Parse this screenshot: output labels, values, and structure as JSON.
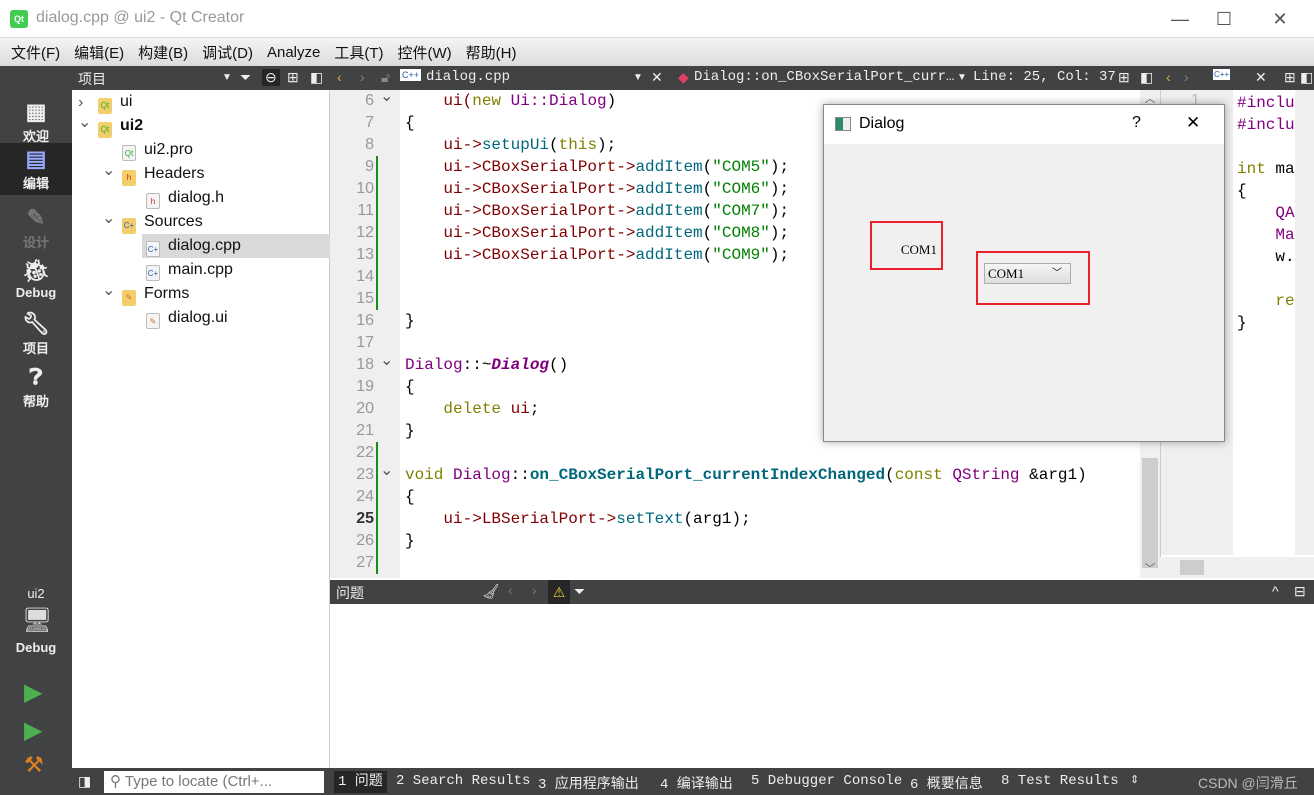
{
  "window": {
    "title": "dialog.cpp @ ui2 - Qt Creator",
    "logo": "Qt",
    "minimize": "—",
    "maximize": "☐",
    "close": "✕"
  },
  "menu": [
    "文件(F)",
    "编辑(E)",
    "构建(B)",
    "调试(D)",
    "Analyze",
    "工具(T)",
    "控件(W)",
    "帮助(H)"
  ],
  "toolbar": {
    "project_label": "项目",
    "file_name": "dialog.cpp",
    "symbol": "Dialog::on_CBoxSerialPort_curr…",
    "position": "Line: 25, Col: 37"
  },
  "modes": [
    {
      "label": "欢迎",
      "icon": "grid-icon"
    },
    {
      "label": "编辑",
      "icon": "edit-icon",
      "selected": true
    },
    {
      "label": "设计",
      "icon": "pencil-icon",
      "disabled": true
    },
    {
      "label": "Debug",
      "icon": "bug-icon"
    },
    {
      "label": "项目",
      "icon": "wrench-icon"
    },
    {
      "label": "帮助",
      "icon": "help-icon"
    }
  ],
  "kit": {
    "project": "ui2",
    "config": "Debug"
  },
  "tree": [
    {
      "label": "ui",
      "level": 0,
      "expand": "collapsed",
      "kind": "qt-folder"
    },
    {
      "label": "ui2",
      "level": 0,
      "expand": "expanded",
      "kind": "qt-folder",
      "bold": true
    },
    {
      "label": "ui2.pro",
      "level": 1,
      "kind": "pro-file"
    },
    {
      "label": "Headers",
      "level": 1,
      "expand": "expanded",
      "kind": "h-folder"
    },
    {
      "label": "dialog.h",
      "level": 2,
      "kind": "h-file"
    },
    {
      "label": "Sources",
      "level": 1,
      "expand": "expanded",
      "kind": "cpp-folder"
    },
    {
      "label": "dialog.cpp",
      "level": 2,
      "kind": "cpp-file",
      "selected": true
    },
    {
      "label": "main.cpp",
      "level": 2,
      "kind": "cpp-file"
    },
    {
      "label": "Forms",
      "level": 1,
      "expand": "expanded",
      "kind": "ui-folder"
    },
    {
      "label": "dialog.ui",
      "level": 2,
      "kind": "ui-file"
    }
  ],
  "editor": {
    "current_line": 25,
    "lines": [
      {
        "n": 6,
        "fold": true,
        "t": [
          [
            "    ui(",
            "mb"
          ],
          [
            "new ",
            "k"
          ],
          [
            "Ui::Dialog",
            "ty"
          ],
          [
            ")",
            "pl"
          ]
        ]
      },
      {
        "n": 7,
        "t": [
          [
            "{",
            "pl"
          ]
        ]
      },
      {
        "n": 8,
        "t": [
          [
            "    ui->",
            "mb"
          ],
          [
            "setupUi",
            "fn"
          ],
          [
            "(",
            "pl"
          ],
          [
            "this",
            "k"
          ],
          [
            ");",
            "pl"
          ]
        ]
      },
      {
        "n": 9,
        "chg": true,
        "t": [
          [
            "    ui->CBoxSerialPort->",
            "mb"
          ],
          [
            "addItem",
            "fn"
          ],
          [
            "(",
            "pl"
          ],
          [
            "\"COM5\"",
            "st"
          ],
          [
            ");",
            "pl"
          ]
        ]
      },
      {
        "n": 10,
        "chg": true,
        "t": [
          [
            "    ui->CBoxSerialPort->",
            "mb"
          ],
          [
            "addItem",
            "fn"
          ],
          [
            "(",
            "pl"
          ],
          [
            "\"COM6\"",
            "st"
          ],
          [
            ");",
            "pl"
          ]
        ]
      },
      {
        "n": 11,
        "chg": true,
        "t": [
          [
            "    ui->CBoxSerialPort->",
            "mb"
          ],
          [
            "addItem",
            "fn"
          ],
          [
            "(",
            "pl"
          ],
          [
            "\"COM7\"",
            "st"
          ],
          [
            ");",
            "pl"
          ]
        ]
      },
      {
        "n": 12,
        "chg": true,
        "t": [
          [
            "    ui->CBoxSerialPort->",
            "mb"
          ],
          [
            "addItem",
            "fn"
          ],
          [
            "(",
            "pl"
          ],
          [
            "\"COM8\"",
            "st"
          ],
          [
            ");",
            "pl"
          ]
        ]
      },
      {
        "n": 13,
        "chg": true,
        "t": [
          [
            "    ui->CBoxSerialPort->",
            "mb"
          ],
          [
            "addItem",
            "fn"
          ],
          [
            "(",
            "pl"
          ],
          [
            "\"COM9\"",
            "st"
          ],
          [
            ");",
            "pl"
          ]
        ]
      },
      {
        "n": 14,
        "chg": true,
        "t": []
      },
      {
        "n": 15,
        "chg": true,
        "t": []
      },
      {
        "n": 16,
        "t": [
          [
            "}",
            "pl"
          ]
        ]
      },
      {
        "n": 17,
        "t": []
      },
      {
        "n": 18,
        "fold": true,
        "t": [
          [
            "Dialog",
            "ty"
          ],
          [
            "::~",
            "pl"
          ],
          [
            "Dialog",
            "it"
          ],
          [
            "()",
            "pl"
          ]
        ]
      },
      {
        "n": 19,
        "t": [
          [
            "{",
            "pl"
          ]
        ]
      },
      {
        "n": 20,
        "t": [
          [
            "    delete ",
            "k"
          ],
          [
            "ui",
            "mb"
          ],
          [
            ";",
            "pl"
          ]
        ]
      },
      {
        "n": 21,
        "t": [
          [
            "}",
            "pl"
          ]
        ]
      },
      {
        "n": 22,
        "chg": true,
        "t": []
      },
      {
        "n": 23,
        "fold": true,
        "chg": true,
        "t": [
          [
            "void ",
            "k"
          ],
          [
            "Dialog",
            "ty"
          ],
          [
            "::",
            "pl"
          ],
          [
            "on_CBoxSerialPort_currentIndexChanged",
            "fd"
          ],
          [
            "(",
            "pl"
          ],
          [
            "const ",
            "k"
          ],
          [
            "QString ",
            "ty"
          ],
          [
            "&arg1)",
            "pl"
          ]
        ]
      },
      {
        "n": 24,
        "chg": true,
        "t": [
          [
            "{",
            "pl"
          ]
        ]
      },
      {
        "n": 25,
        "chg": true,
        "t": [
          [
            "    ui->LBSerialPort->",
            "mb"
          ],
          [
            "setText",
            "fn"
          ],
          [
            "(arg1);",
            "pl"
          ]
        ]
      },
      {
        "n": 26,
        "chg": true,
        "t": [
          [
            "}",
            "pl"
          ]
        ]
      },
      {
        "n": 27,
        "chg": true,
        "t": []
      }
    ]
  },
  "right_editor": {
    "line_number": "1",
    "lines": [
      [
        [
          "#inclu",
          "ty"
        ]
      ],
      [
        [
          "#inclu",
          "ty"
        ]
      ],
      [],
      [
        [
          "int ",
          "k"
        ],
        [
          "ma",
          "pl"
        ]
      ],
      [
        [
          "{",
          "pl"
        ]
      ],
      [
        [
          "    QA",
          "ty"
        ]
      ],
      [
        [
          "    Ma",
          "ty"
        ]
      ],
      [
        [
          "    w.",
          "pl"
        ]
      ],
      [],
      [
        [
          "    re",
          "k"
        ]
      ],
      [
        [
          "}",
          "pl"
        ]
      ]
    ]
  },
  "dialog": {
    "title": "Dialog",
    "help": "?",
    "close": "✕",
    "label_text": "COM1",
    "combo_value": "COM1"
  },
  "panel": {
    "title": "问题"
  },
  "statusbar": {
    "locate_placeholder": "Type to locate (Ctrl+...",
    "tabs": [
      "1 问题",
      "2 Search Results",
      "3 应用程序输出",
      "4 编译输出",
      "5 Debugger Console",
      "6 概要信息",
      "8 Test Results"
    ],
    "watermark": "CSDN @闫滑丘"
  },
  "colors": {
    "highlight_box": "#e8202a",
    "dark_chrome": "#404244",
    "change_marker": "#1a8a1a"
  }
}
